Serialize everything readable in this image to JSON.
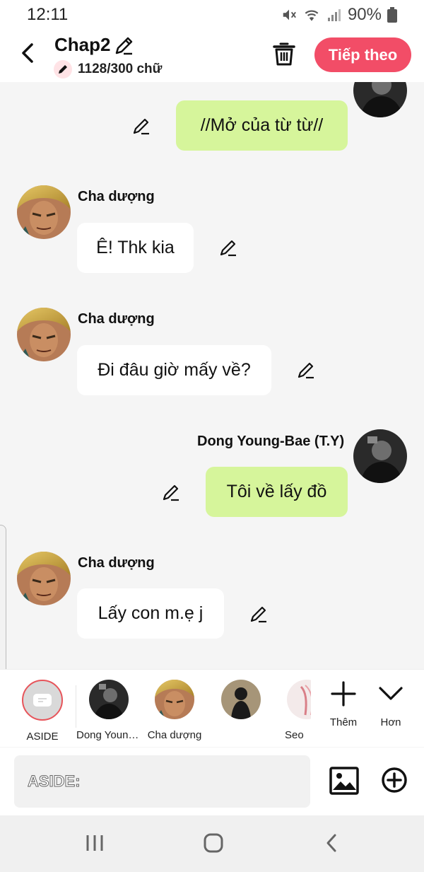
{
  "status": {
    "time": "12:11",
    "battery": "90%"
  },
  "header": {
    "title": "Chap2",
    "word_count": "1128/300 chữ",
    "next_label": "Tiếp theo"
  },
  "messages": [
    {
      "side": "right",
      "text": "//Mở của từ từ//"
    },
    {
      "side": "left",
      "name": "Cha dượng",
      "text": "Ê! Thk kia"
    },
    {
      "side": "left",
      "name": "Cha dượng",
      "text": "Đi đâu giờ mấy về?"
    },
    {
      "side": "right",
      "name": "Dong Young-Bae (T.Y)",
      "text": "Tôi về lấy đồ"
    },
    {
      "side": "left",
      "name": "Cha dượng",
      "text": "Lấy con m.ẹ j"
    }
  ],
  "characters": [
    {
      "label": "ASIDE",
      "selected": true
    },
    {
      "label": "Dong Young-Bae (T.Y)"
    },
    {
      "label": "Cha dượng"
    },
    {
      "label": ""
    },
    {
      "label": "Seo"
    }
  ],
  "actions": {
    "add_label": "Thêm",
    "more_label": "Hơn"
  },
  "input": {
    "placeholder": "ASIDE:"
  },
  "colors": {
    "accent": "#f24d67",
    "right_bubble": "#d6f59b",
    "left_bubble": "#ffffff"
  }
}
